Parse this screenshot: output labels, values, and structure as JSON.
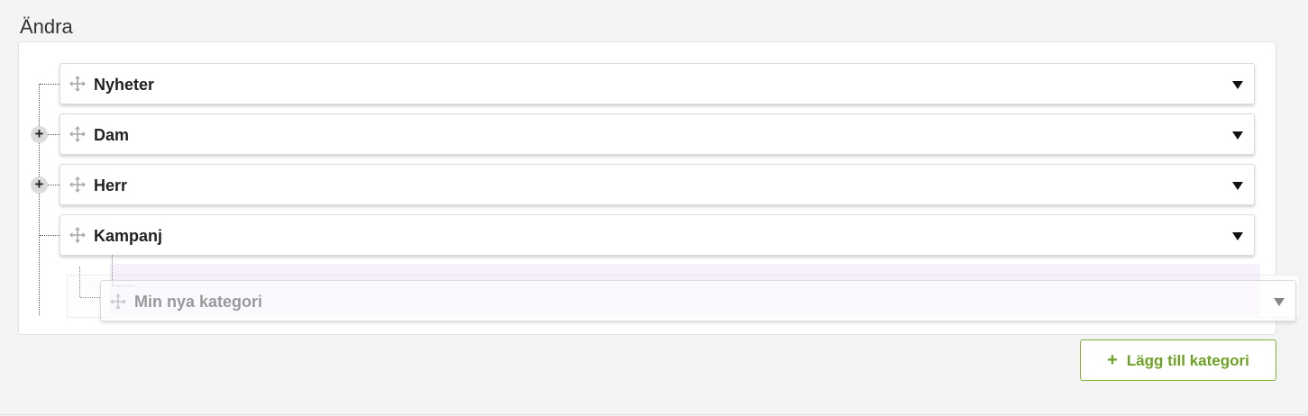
{
  "section": {
    "title": "Ändra"
  },
  "categories": [
    {
      "label": "Nyheter",
      "expandable": false
    },
    {
      "label": "Dam",
      "expandable": true
    },
    {
      "label": "Herr",
      "expandable": true
    },
    {
      "label": "Kampanj",
      "expandable": false
    }
  ],
  "dragging": {
    "label": "Min nya kategori"
  },
  "actions": {
    "add_icon": "+",
    "add_label": "Lägg till kategori"
  },
  "icons": {
    "expand": "+",
    "drag": "move-arrows-icon",
    "caret": "caret-down-icon"
  },
  "colors": {
    "accent": "#7db134",
    "accent_text": "#6da224",
    "ghost_highlight": "#ece0fa"
  }
}
